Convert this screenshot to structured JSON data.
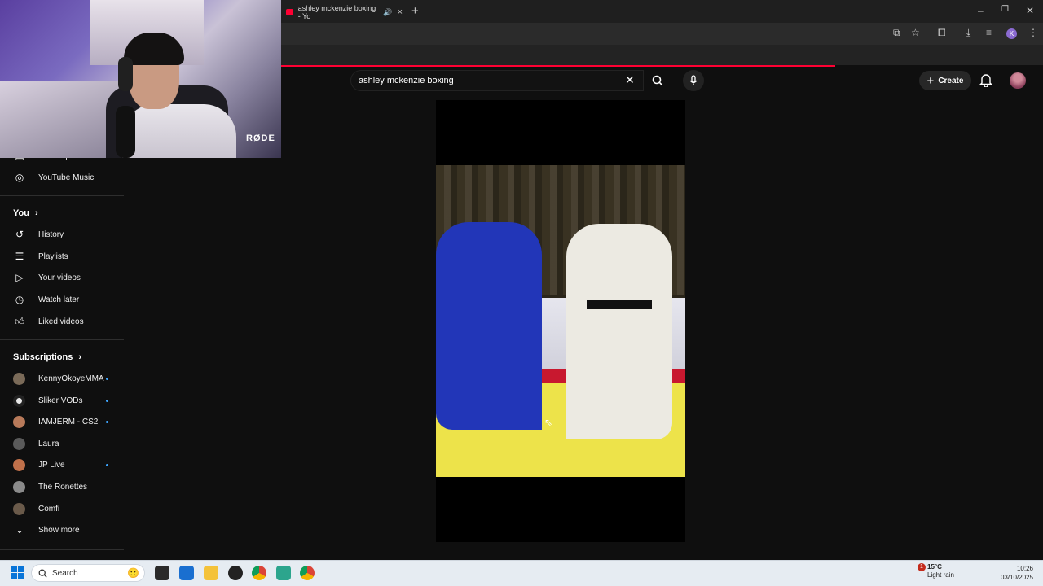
{
  "browser": {
    "tab_title": "ashley mckenzie boxing - Yo",
    "new_tab": "+",
    "tab_close": "×",
    "window_controls": [
      "–",
      "❐",
      "✕"
    ],
    "profile_initial": "K"
  },
  "youtube": {
    "search_query": "ashley mckenzie boxing",
    "create_label": "Create",
    "create_icon": "+"
  },
  "sidebar": {
    "top_items": [
      {
        "label": "Subscriptions",
        "icon": "subscriptions-icon"
      },
      {
        "label": "YouTube Music",
        "icon": "music-icon"
      }
    ],
    "you_section": {
      "title": "You",
      "chevron": "›",
      "items": [
        {
          "label": "History",
          "icon": "history-icon"
        },
        {
          "label": "Playlists",
          "icon": "playlists-icon"
        },
        {
          "label": "Your videos",
          "icon": "your-videos-icon"
        },
        {
          "label": "Watch later",
          "icon": "watch-later-icon"
        },
        {
          "label": "Liked videos",
          "icon": "liked-videos-icon"
        }
      ]
    },
    "subscriptions_section": {
      "title": "Subscriptions",
      "chevron": "›",
      "channels": [
        {
          "label": "KennyOkoyeMMA",
          "new": true,
          "color": "#7a6a58"
        },
        {
          "label": "Sliker VODs",
          "new": true,
          "color": "#e8e8e8"
        },
        {
          "label": "IAMJERM - CS2",
          "new": true,
          "color": "#b87a5a"
        },
        {
          "label": "Laura",
          "new": false,
          "color": "#5a5a5a"
        },
        {
          "label": "JP Live",
          "new": true,
          "color": "#c0704a"
        },
        {
          "label": "The Ronettes",
          "new": false,
          "color": "#8a8a8a"
        },
        {
          "label": "Comfi",
          "new": false,
          "color": "#6a5a4a"
        }
      ],
      "show_more": "Show more"
    }
  },
  "webcam": {
    "mic_brand": "RØDE"
  },
  "taskbar": {
    "search_placeholder": "Search",
    "weather_temp": "15°C",
    "weather_desc": "Light rain",
    "weather_badge": "1",
    "time": "10:26",
    "date": "03/10/2025"
  },
  "colors": {
    "accent": "#ff0033",
    "background": "#0f0f0f",
    "link_dot": "#3ea6ff"
  }
}
